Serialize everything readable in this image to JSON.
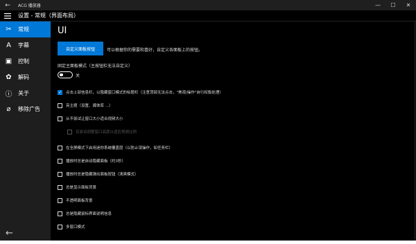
{
  "titlebar": {
    "title": "ACG 播放器",
    "back_glyph": "←",
    "min_glyph": "—",
    "max_glyph": "☐",
    "close_glyph": "✕"
  },
  "header": {
    "title": "设置 - 常规（界面布局）"
  },
  "sidebar": {
    "items": [
      {
        "label": "常规",
        "icon": "wrench-icon",
        "glyph": "✂",
        "active": true
      },
      {
        "label": "字幕",
        "icon": "subtitle-icon",
        "glyph": "A",
        "active": false
      },
      {
        "label": "控制",
        "icon": "control-icon",
        "glyph": "▣",
        "active": false
      },
      {
        "label": "解码",
        "icon": "puzzle-icon",
        "glyph": "✿",
        "active": false
      },
      {
        "label": "关于",
        "icon": "info-icon",
        "glyph": "ⓘ",
        "active": false
      },
      {
        "label": "移除广告",
        "icon": "no-ad-icon",
        "glyph": "⌀",
        "active": false
      }
    ],
    "back_glyph": "←"
  },
  "main": {
    "title": "UI",
    "customize_button": "自定义面板按钮",
    "customize_desc": "可以根据你的需要和喜好，自定义各面板上的按钮。",
    "fixed_panel_label": "固定主面板模式（主按钮栏无法自定义）",
    "toggle_state": "关",
    "toggle_on": false,
    "options": [
      {
        "label": "点击上部信息栏，以隐藏窗口模式的标题栏（注意顶部无法点击，\"美观/操作\"自行权衡处理）",
        "checked": true,
        "disabled": false
      },
      {
        "label": "亮主题（设置、媒体库 ...）",
        "checked": false,
        "disabled": false
      },
      {
        "label": "从不尝试让窗口大小适合视频大小",
        "checked": false,
        "disabled": false
      },
      {
        "label": "仅尝试调整窗口高度以适应视频比例",
        "checked": false,
        "disabled": true
      },
      {
        "label": "在全屏模式下启用迷你系统覆盖层（以防止误操作，如任务栏）",
        "checked": false,
        "disabled": false
      },
      {
        "label": "播放时总是自动隐藏面板（约3秒）",
        "checked": false,
        "disabled": false
      },
      {
        "label": "播放时总是隐藏弹出面板按钮（清爽模式）",
        "checked": false,
        "disabled": false
      },
      {
        "label": "总是显示面板背景",
        "checked": false,
        "disabled": false
      },
      {
        "label": "不透明面板背景",
        "checked": false,
        "disabled": false
      },
      {
        "label": "总是隐藏鼠标界面说明信息",
        "checked": false,
        "disabled": false
      },
      {
        "label": "多窗口模式",
        "checked": false,
        "disabled": false
      }
    ]
  }
}
